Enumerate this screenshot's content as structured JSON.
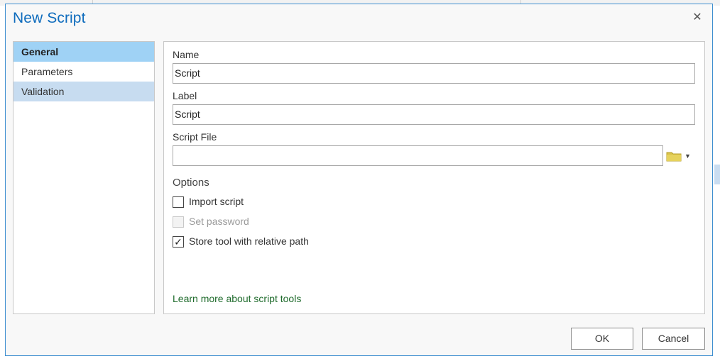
{
  "dialog": {
    "title": "New Script",
    "close_glyph": "✕"
  },
  "nav": {
    "items": [
      {
        "label": "General",
        "state": "selected"
      },
      {
        "label": "Parameters",
        "state": "normal"
      },
      {
        "label": "Validation",
        "state": "hover"
      }
    ]
  },
  "general": {
    "name_label": "Name",
    "name_value": "Script",
    "label_label": "Label",
    "label_value": "Script",
    "script_file_label": "Script File",
    "script_file_value": "",
    "options_heading": "Options",
    "options": [
      {
        "label": "Import script",
        "checked": false,
        "enabled": true
      },
      {
        "label": "Set password",
        "checked": false,
        "enabled": false
      },
      {
        "label": "Store tool with relative path",
        "checked": true,
        "enabled": true
      }
    ],
    "learn_more_link": "Learn more about script tools"
  },
  "icons": {
    "folder": "folder-icon",
    "dropdown": "caret-down-icon",
    "check": "✓"
  },
  "buttons": {
    "ok": "OK",
    "cancel": "Cancel"
  },
  "colors": {
    "title": "#0f6cbd",
    "selected_nav": "#9fd2f5",
    "hover_nav": "#c7dcf0",
    "link": "#1f6b2c",
    "folder": "#d8c24a"
  }
}
